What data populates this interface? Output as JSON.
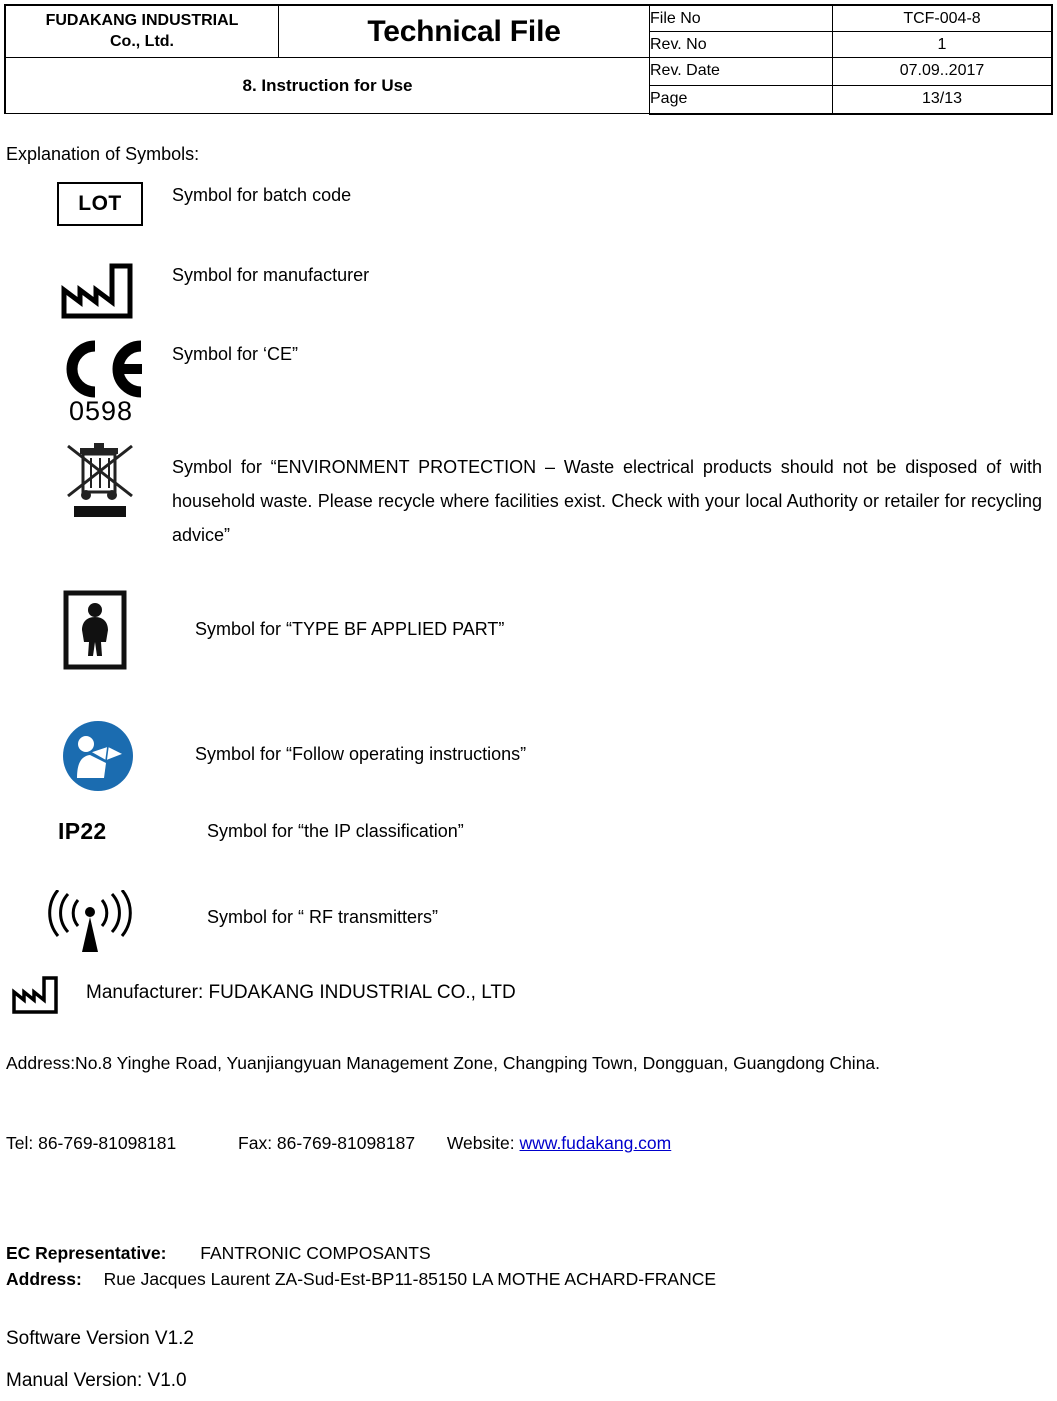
{
  "header": {
    "company_line1": "FUDAKANG INDUSTRIAL",
    "company_line2": "Co., Ltd.",
    "doc_title": "Technical File",
    "doc_subtitle": "8. Instruction for Use",
    "fields": [
      {
        "label": "File No",
        "value": "TCF-004-8"
      },
      {
        "label": "Rev. No",
        "value": "1"
      },
      {
        "label": "Rev. Date",
        "value": "07.09..2017"
      },
      {
        "label": "Page",
        "value": "13/13"
      }
    ]
  },
  "body": {
    "explanation_heading": "Explanation of Symbols:",
    "symbols": [
      {
        "icon": "lot-box-icon",
        "label": "LOT",
        "description": "Symbol for batch code"
      },
      {
        "icon": "factory-manufacturer-icon",
        "label": "",
        "description": "Symbol for manufacturer"
      },
      {
        "icon": "ce-mark-icon",
        "label": "0598",
        "description": "Symbol for ‘CE”"
      },
      {
        "icon": "weee-crossed-bin-icon",
        "label": "",
        "description": "Symbol for “ENVIRONMENT PROTECTION – Waste electrical products should not be disposed of with household waste. Please recycle where facilities exist. Check with your local Authority or retailer for recycling advice”"
      },
      {
        "icon": "type-bf-applied-part-icon",
        "label": "",
        "description": "Symbol for “TYPE BF APPLIED PART”"
      },
      {
        "icon": "follow-instructions-icon",
        "label": "",
        "description": "Symbol for “Follow operating instructions”"
      },
      {
        "icon": "ip-rating-icon",
        "label": "IP22",
        "description": "Symbol for “the IP classification”"
      },
      {
        "icon": "rf-transmitter-icon",
        "label": "",
        "description": "Symbol for “ RF transmitters”"
      }
    ]
  },
  "footer": {
    "manufacturer_line": "Manufacturer: FUDAKANG INDUSTRIAL CO., LTD",
    "address_line": "Address:No.8 Yinghe Road, Yuanjiangyuan Management Zone, Changping Town, Dongguan, Guangdong China.",
    "tel": "Tel: 86-769-81098181",
    "fax": "Fax: 86-769-81098187",
    "website_label": "Website:",
    "website_url": "www.fudakang.com",
    "ec_rep_label": "EC Representative:",
    "ec_rep_value": "FANTRONIC COMPOSANTS",
    "ec_address_label": "Address:",
    "ec_address_value": "Rue Jacques Laurent ZA-Sud-Est-BP11-85150 LA MOTHE ACHARD-FRANCE",
    "software_version": "Software Version V1.2",
    "manual_version": "Manual Version: V1.0"
  },
  "colors": {
    "link": "#0000cc",
    "instruction_icon_blue": "#1b6cb0",
    "text": "#000000"
  }
}
